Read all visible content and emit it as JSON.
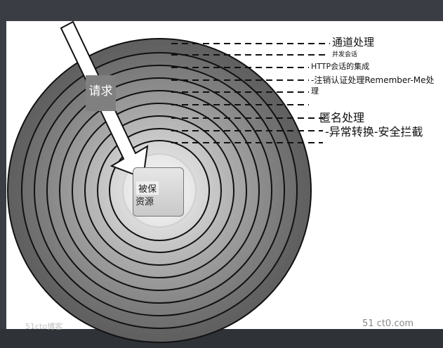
{
  "labels": {
    "channel": "通道处理",
    "concurrent": "并发会话",
    "http_session": "HTTP会话的集成",
    "logout_line1": "-注销认证处理Remember-Me处",
    "logout_line2": "理",
    "anonymous": "匿名处理",
    "exception": "-异常转换-安全拦截"
  },
  "request": "请求",
  "resource": {
    "line1": "被保",
    "line2": "资源"
  },
  "watermark": {
    "right": "51 ct0.com",
    "left": "51cto博客"
  },
  "colors": {
    "ring_outer": "#6e6e6e",
    "ring_inner": "#ffffff",
    "ring_stroke": "#111111",
    "request_box": "#808080"
  }
}
